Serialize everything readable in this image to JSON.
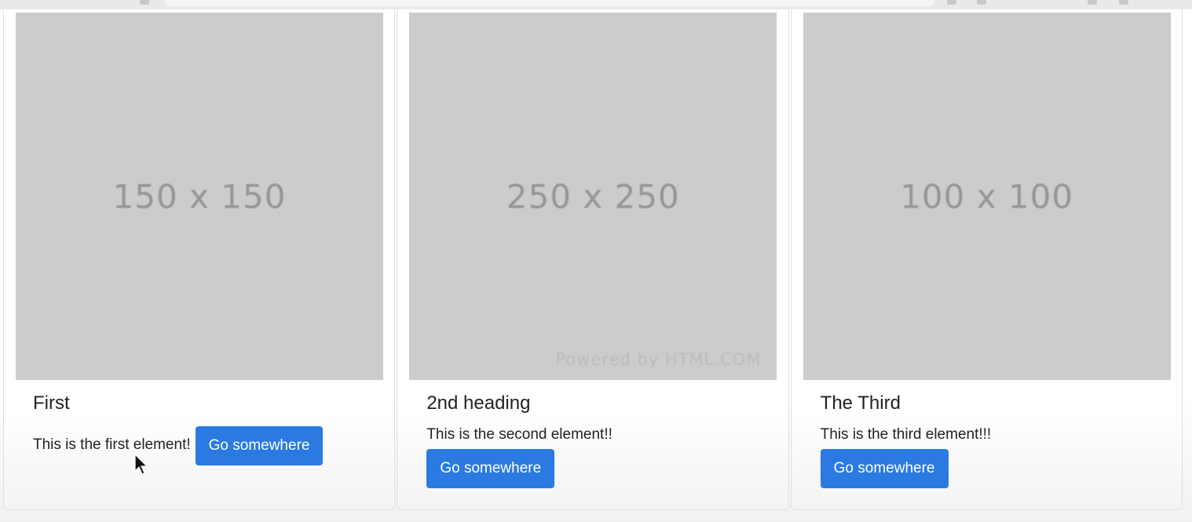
{
  "cards": [
    {
      "image_label": "150 x 150",
      "title": "First",
      "text": "This is the first element!",
      "button_label": "Go somewhere"
    },
    {
      "image_label": "250 x 250",
      "image_watermark": "Powered by HTML.COM",
      "title": "2nd heading",
      "text": "This is the second element!!",
      "button_label": "Go somewhere"
    },
    {
      "image_label": "100 x 100",
      "title": "The Third",
      "text": "This is the third element!!!",
      "button_label": "Go somewhere"
    }
  ],
  "colors": {
    "button_bg": "#2a7ae2",
    "image_placeholder": "#cccccc"
  },
  "icons": {
    "pointer": "mouse-pointer-icon"
  }
}
